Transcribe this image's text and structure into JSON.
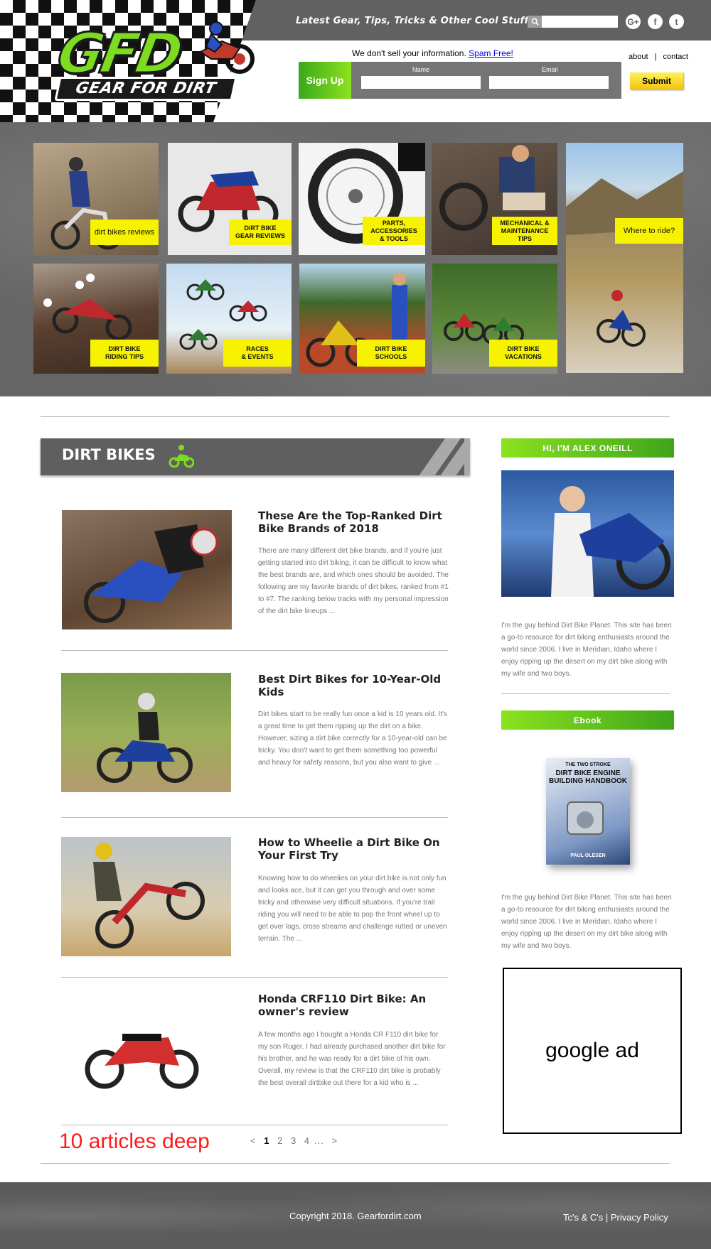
{
  "header": {
    "tagline": "Latest Gear, Tips, Tricks & Other Cool Stuff",
    "logo_top": "GFD",
    "logo_bottom": "GEAR FOR DIRT",
    "signup_message": "We don't sell your information.",
    "signup_link": "Spam Free!",
    "signup_button": "Sign Up",
    "name_label": "Name",
    "email_label": "Email",
    "submit_label": "Submit",
    "about_label": "about",
    "separator": "|",
    "contact_label": "contact",
    "social": [
      {
        "icon": "google-plus-icon",
        "glyph": "G+"
      },
      {
        "icon": "facebook-icon",
        "glyph": "f"
      },
      {
        "icon": "twitter-icon",
        "glyph": "t"
      }
    ]
  },
  "categories": [
    {
      "label": "dirt bikes reviews"
    },
    {
      "label": "DIRT BIKE\nGEAR REVIEWS"
    },
    {
      "label": "PARTS,\nACCESSORIES\n& TOOLS"
    },
    {
      "label": "MECHANICAL &\nMAINTENANCE\nTIPS"
    },
    {
      "label": "Where to ride?"
    },
    {
      "label": "DIRT BIKE\nRIDING TIPS"
    },
    {
      "label": "RACES\n& EVENTS"
    },
    {
      "label": "DIRT BIKE\nSCHOOLS"
    },
    {
      "label": "DIRT BIKE\nVACATIONS"
    }
  ],
  "section": {
    "title": "DIRT BIKES"
  },
  "articles": [
    {
      "title": "These Are the Top-Ranked Dirt Bike Brands of 2018",
      "excerpt": "There are many different dirt bike brands, and if you're just getting started into dirt biking, it can be difficult to know what the best brands are, and which ones should be avoided. The following are my favorite brands of dirt bikes, ranked from #1 to #7.  The ranking below tracks with my personal impression of the dirt bike lineups ..."
    },
    {
      "title": "Best Dirt Bikes for 10-Year-Old Kids",
      "excerpt": "Dirt bikes start to be really fun once a kid is 10 years old.  It's a great time to get them ripping up the dirt on a bike.  However, sizing a dirt bike correctly for a 10-year-old can be tricky.  You don't want to get them something too powerful and heavy for safety reasons, but you also want to give ..."
    },
    {
      "title": "How to Wheelie a Dirt Bike On Your First Try",
      "excerpt": "Knowing how to do wheelies on your dirt bike is not only fun and looks ace, but it can get you through and over some tricky and otherwise very difficult situations. If you're trail riding you will need to be able to pop the front wheel up to get over logs, cross streams and challenge rutted or uneven terrain. The ..."
    },
    {
      "title": "Honda CRF110 Dirt Bike: An owner's review",
      "excerpt": "  A few months ago I bought a Honda CR F110 dirt bike for my son Ruger. I had already purchased another dirt bike for his brother, and he was ready for a dirt bike of his own. Overall, my review is that the CRF110 dirt bike is probably the best overall dirtbike out there for a kid who is ..."
    }
  ],
  "pagination": {
    "note": "10 articles deep",
    "prev": "<",
    "pages": [
      "1",
      "2",
      "3",
      "4"
    ],
    "ellipsis": "...",
    "next": ">"
  },
  "sidebar": {
    "about_heading": "HI, I'M ALEX ONEILL",
    "about_text": "I'm the guy behind Dirt Bike Planet.  This site has been a go-to resource for dirt biking enthusiasts around the world since 2006.  I live in Meridian, Idaho where I enjoy ripping up the desert on my dirt bike along with my wife and two boys.",
    "ebook_heading": "Ebook",
    "ebook_cover_small": "THE TWO STROKE",
    "ebook_cover_title": "DIRT BIKE ENGINE BUILDING HANDBOOK",
    "ebook_author": "PAUL OLESEN",
    "ebook_text": "I'm the guy behind Dirt Bike Planet.  This site has been a go-to resource for dirt biking enthusiasts around the world since 2006.  I live in Meridian, Idaho where I enjoy ripping up the desert on my dirt bike along with my wife and two boys.",
    "ad_label": "google ad"
  },
  "footer": {
    "copyright": "Copyright 2018. Gearfordirt.com",
    "legal": "Tc's & C's | Privacy Policy"
  },
  "colors": {
    "accent_green": "#6ccf1d",
    "label_yellow": "#f7f200",
    "band_gray": "#666666"
  }
}
